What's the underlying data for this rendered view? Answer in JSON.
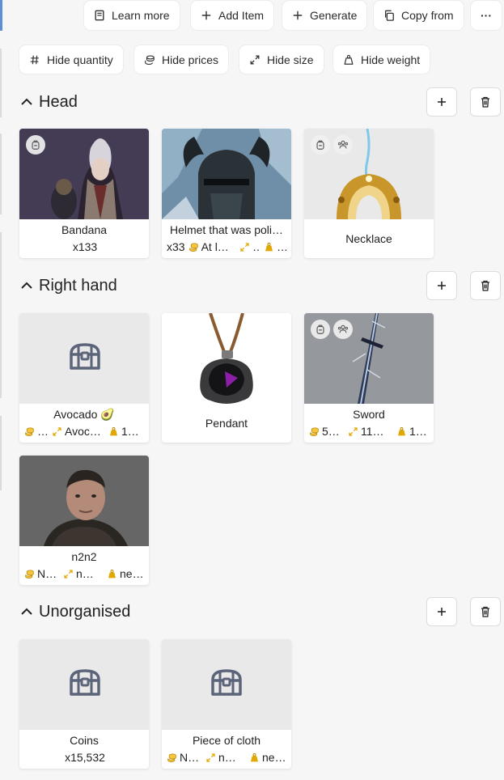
{
  "toolbar": {
    "learn_more": "Learn more",
    "add_item": "Add Item",
    "generate": "Generate",
    "copy_from": "Copy from",
    "more": "···"
  },
  "filters": {
    "hide_quantity": "Hide quantity",
    "hide_prices": "Hide prices",
    "hide_size": "Hide size",
    "hide_weight": "Hide weight"
  },
  "sections": [
    {
      "title": "Head",
      "items": [
        {
          "name": "Bandana",
          "quantity": "x133"
        },
        {
          "name": "Helmet that was poli…",
          "quantity": "x33",
          "price": "At l…",
          "size": "…",
          "weight": "…"
        },
        {
          "name": "Necklace"
        }
      ]
    },
    {
      "title": "Right hand",
      "items": [
        {
          "name": "Avocado 🥑",
          "price": "…",
          "size": "Avoc…",
          "weight": "1…"
        },
        {
          "name": "Pendant"
        },
        {
          "name": "Sword",
          "price": "5…",
          "size": "11…",
          "weight": "1…"
        },
        {
          "name": "n2n2",
          "price": "N…",
          "size": "n…",
          "weight": "ne…"
        }
      ]
    },
    {
      "title": "Unorganised",
      "items": [
        {
          "name": "Coins",
          "quantity": "x15,532"
        },
        {
          "name": "Piece of cloth",
          "price": "N…",
          "size": "n…",
          "weight": "ne…"
        }
      ]
    }
  ],
  "colors": {
    "accent": "#5b8fd6",
    "coin": "#e0a800",
    "size_arrow": "#e0a800",
    "chest": "#5b6478"
  }
}
